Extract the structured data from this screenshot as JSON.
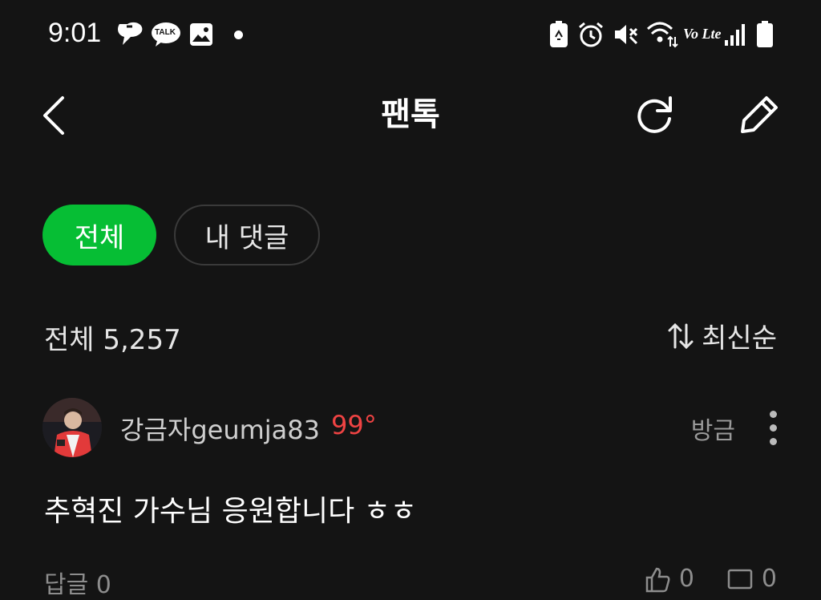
{
  "status_bar": {
    "time": "9:01",
    "icons": [
      "chat-bubble-icon",
      "kakaotalk-icon",
      "image-icon",
      "dot-icon",
      "battery-saver-icon",
      "alarm-icon",
      "mute-icon",
      "wifi-icon",
      "volte-icon",
      "signal-icon",
      "battery-icon"
    ],
    "talk_label": "TALK",
    "volte_label": "Vo Lte"
  },
  "header": {
    "title": "팬톡",
    "back_icon": "chevron-left-icon",
    "refresh_icon": "refresh-icon",
    "write_icon": "pencil-icon"
  },
  "tabs": [
    {
      "label": "전체",
      "active": true
    },
    {
      "label": "내 댓글",
      "active": false
    }
  ],
  "summary": {
    "count_label": "전체 5,257",
    "sort_label": "최신순",
    "sort_icon": "sort-arrows-icon"
  },
  "comment": {
    "author": "강금자geumja83",
    "temperature": "99°",
    "time": "방금",
    "text": "추혁진 가수님 응원합니다 ㅎㅎ",
    "reply_label": "답글 0",
    "like_count": "0",
    "report_count": "0"
  },
  "colors": {
    "background": "#141414",
    "accent_green": "#06be34",
    "temperature_red": "#ef4343"
  }
}
